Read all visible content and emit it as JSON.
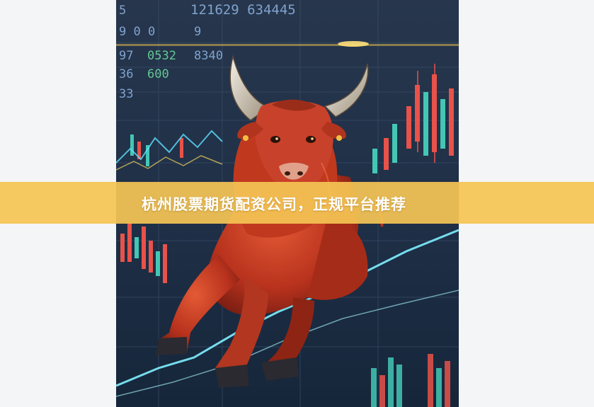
{
  "banner": {
    "title": "杭州股票期货配资公司，正规平台推荐"
  },
  "hero": {
    "subject": "bull-illustration",
    "screen_numbers": [
      "121629 634445",
      "9 0 0",
      "97",
      "8340",
      "33",
      "600",
      "36"
    ]
  },
  "colors": {
    "banner": "#f4c454",
    "bull": "#c53a22",
    "candle_up": "#e8524a",
    "candle_down": "#43c7b4",
    "glow_line": "#7ff0ff",
    "screen_bg": "#1d2b3f"
  }
}
